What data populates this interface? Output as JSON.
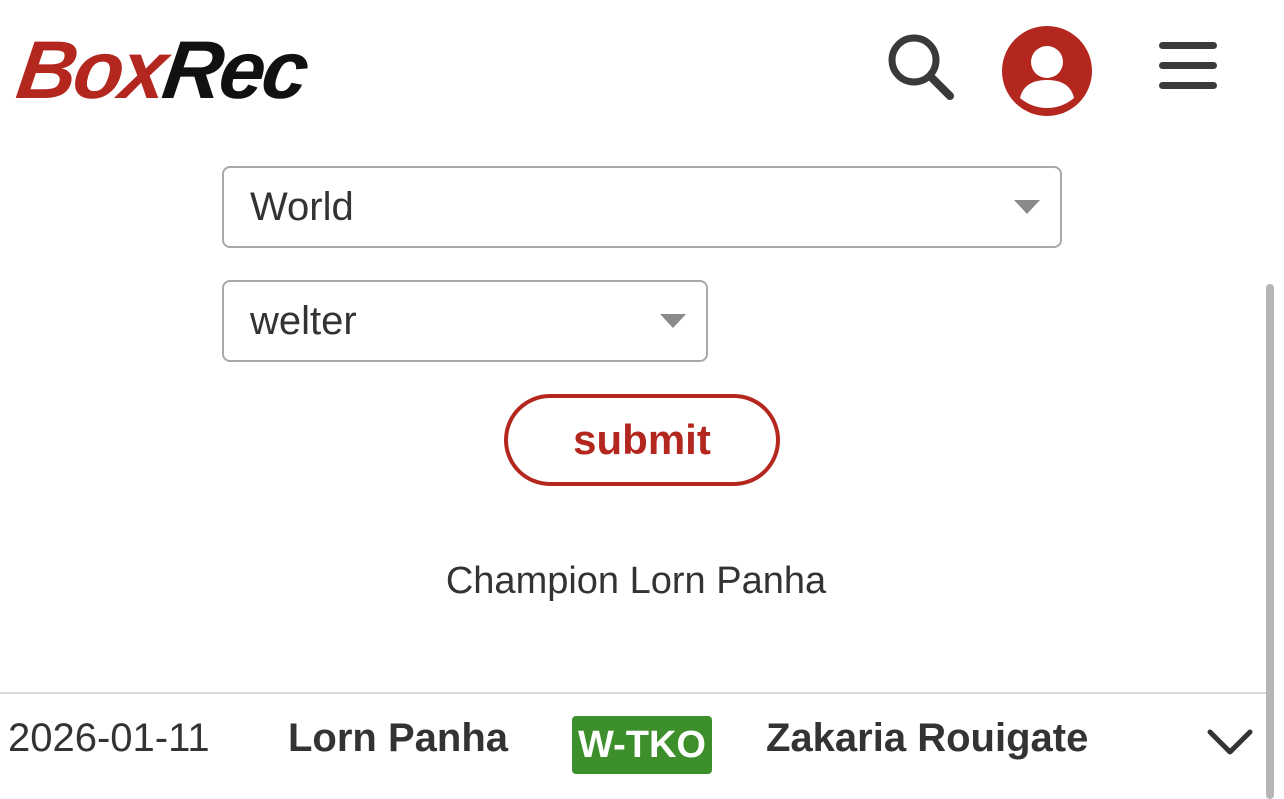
{
  "brand": {
    "logo_part1": "Box",
    "logo_part2": "Rec",
    "accent_color": "#b3271f"
  },
  "header": {
    "search_icon": "search-icon",
    "account_icon": "user-account-icon",
    "menu_icon": "hamburger-menu-icon"
  },
  "form": {
    "region_select": {
      "value": "World"
    },
    "division_select": {
      "value": "welter"
    },
    "submit_label": "submit"
  },
  "champion_text": "Champion Lorn Panha",
  "fights": [
    {
      "date": "2026-01-11",
      "boxer1": "Lorn Panha",
      "result": "W-TKO",
      "result_color": "#3c8f2b",
      "boxer2": "Zakaria Rouigate",
      "expand_icon": "chevron-down-icon"
    }
  ]
}
